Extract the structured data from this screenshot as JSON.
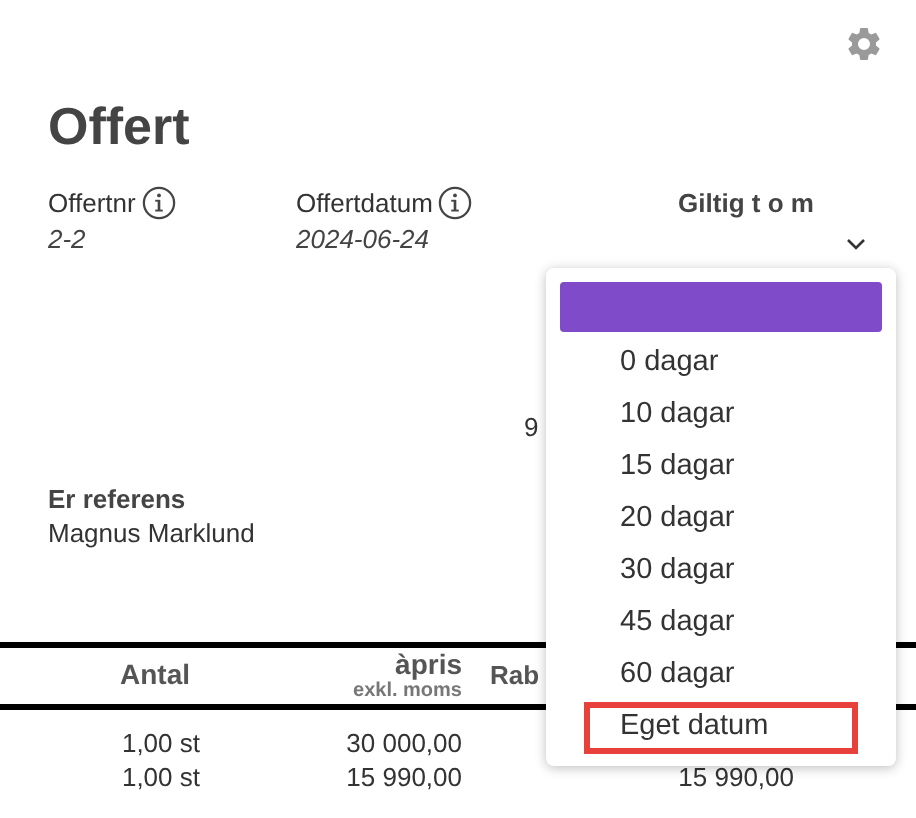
{
  "title": "Offert",
  "fields": [
    {
      "label": "Offertnr",
      "value": "2-2",
      "info": true
    },
    {
      "label": "Offertdatum",
      "value": "2024-06-24",
      "info": true
    }
  ],
  "valid_until": {
    "label": "Giltig t o m",
    "expanded": true
  },
  "partial_value": "9",
  "reference": {
    "label": "Er referens",
    "value": "Magnus Marklund"
  },
  "table": {
    "columns": [
      {
        "label": "Antal"
      },
      {
        "label": "àpris",
        "sublabel": "exkl. moms"
      },
      {
        "label": "Rab"
      }
    ],
    "rows": [
      {
        "quantity": "1,00 st",
        "unit_price": "30 000,00"
      },
      {
        "quantity": "1,00 st",
        "unit_price": "15 990,00",
        "column_3": "15 990,00"
      }
    ]
  },
  "dropdown": [
    {
      "kind": "blank",
      "selected": true,
      "focused": false
    },
    {
      "kind": "option",
      "label": "0 dagar",
      "selected": false,
      "focused": false
    },
    {
      "kind": "option",
      "label": "10 dagar",
      "selected": false,
      "focused": false
    },
    {
      "kind": "option",
      "label": "15 dagar",
      "selected": false,
      "focused": false
    },
    {
      "kind": "option",
      "label": "20 dagar",
      "selected": false,
      "focused": false
    },
    {
      "kind": "option",
      "label": "30 dagar",
      "selected": false,
      "focused": false
    },
    {
      "kind": "option",
      "label": "45 dagar",
      "selected": false,
      "focused": false
    },
    {
      "kind": "option",
      "label": "60 dagar",
      "selected": false,
      "focused": false
    },
    {
      "kind": "option",
      "label": "Eget datum",
      "selected": false,
      "focused": true
    }
  ]
}
